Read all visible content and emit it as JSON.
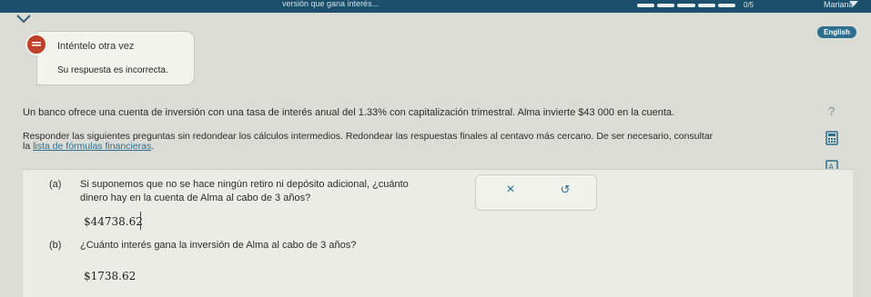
{
  "topbar": {
    "topic": "versión que gana interés...",
    "count": "0/5",
    "user": "Mariana"
  },
  "language_button": "English",
  "feedback": {
    "title": "Inténtelo otra vez",
    "message": "Su respuesta es incorrecta."
  },
  "problem": {
    "statement": "Un banco ofrece una cuenta de inversión con una tasa de interés anual del 1.33% con capitalización trimestral. Alma invierte $43 000 en la cuenta.",
    "instructions_1": "Responder las siguientes preguntas sin redondear los cálculos intermedios. Redondear las respuestas finales al centavo más cercano. De ser necesario, consultar",
    "instructions_pre": "la ",
    "link_text": "lista de fórmulas financieras",
    "instructions_post": "."
  },
  "parts": [
    {
      "label": "(a)",
      "question_line1": "Si suponemos que no se hace ningún retiro ni depósito adicional, ¿cuánto",
      "question_line2": "dinero hay en la cuenta de Alma al cabo de 3 años?",
      "answer": "$44738.62"
    },
    {
      "label": "(b)",
      "question": "¿Cuánto interés gana la inversión de Alma al cabo de 3 años?",
      "answer": "$1738.62"
    }
  ],
  "actions": {
    "clear_symbol": "×",
    "undo_symbol": "↺"
  },
  "help_symbol": "?",
  "icons": {
    "feedback": "alert-icon",
    "calculator": "calculator-icon",
    "text_tool": "text-tool-icon",
    "message": "message-icon",
    "chevron": "chevron-down-icon"
  }
}
